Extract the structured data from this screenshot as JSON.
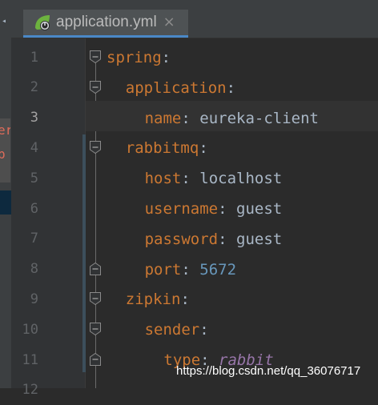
{
  "tab": {
    "label": "application.yml",
    "close_glyph": "×",
    "icon": "spring-leaf-icon",
    "icon_color": "#6db33f"
  },
  "side_panel": {
    "fragments": [
      "er",
      "p"
    ]
  },
  "editor": {
    "current_line": 3,
    "lines": [
      {
        "number": "1",
        "parts": [
          {
            "t": "key",
            "v": "spring"
          },
          {
            "t": "punct",
            "v": ":"
          }
        ]
      },
      {
        "number": "2",
        "parts": [
          {
            "t": "key",
            "v": "application"
          },
          {
            "t": "punct",
            "v": ":"
          }
        ]
      },
      {
        "number": "3",
        "parts": [
          {
            "t": "key",
            "v": "name"
          },
          {
            "t": "punct",
            "v": ": "
          },
          {
            "t": "plain",
            "v": "eureka-client"
          }
        ]
      },
      {
        "number": "4",
        "parts": [
          {
            "t": "key",
            "v": "rabbitmq"
          },
          {
            "t": "punct",
            "v": ":"
          }
        ]
      },
      {
        "number": "5",
        "parts": [
          {
            "t": "key",
            "v": "host"
          },
          {
            "t": "punct",
            "v": ": "
          },
          {
            "t": "plain",
            "v": "localhost"
          }
        ]
      },
      {
        "number": "6",
        "parts": [
          {
            "t": "key",
            "v": "username"
          },
          {
            "t": "punct",
            "v": ": "
          },
          {
            "t": "plain",
            "v": "guest"
          }
        ]
      },
      {
        "number": "7",
        "parts": [
          {
            "t": "key",
            "v": "password"
          },
          {
            "t": "punct",
            "v": ": "
          },
          {
            "t": "plain",
            "v": "guest"
          }
        ]
      },
      {
        "number": "8",
        "parts": [
          {
            "t": "key",
            "v": "port"
          },
          {
            "t": "punct",
            "v": ": "
          },
          {
            "t": "num",
            "v": "5672"
          }
        ]
      },
      {
        "number": "9",
        "parts": [
          {
            "t": "key",
            "v": "zipkin"
          },
          {
            "t": "punct",
            "v": ":"
          }
        ]
      },
      {
        "number": "10",
        "parts": [
          {
            "t": "key",
            "v": "sender"
          },
          {
            "t": "punct",
            "v": ":"
          }
        ]
      },
      {
        "number": "11",
        "parts": [
          {
            "t": "key",
            "v": "type"
          },
          {
            "t": "punct",
            "v": ": "
          },
          {
            "t": "ital",
            "v": "rabbit"
          }
        ]
      },
      {
        "number": "12",
        "parts": []
      }
    ]
  },
  "colors": {
    "keyword": "#cc7832",
    "number": "#6897bb",
    "constant": "#9876aa",
    "text": "#a9b7c6",
    "background": "#2b2b2b",
    "gutter": "#313335"
  },
  "watermark": "https://blog.csdn.net/qq_36076717"
}
